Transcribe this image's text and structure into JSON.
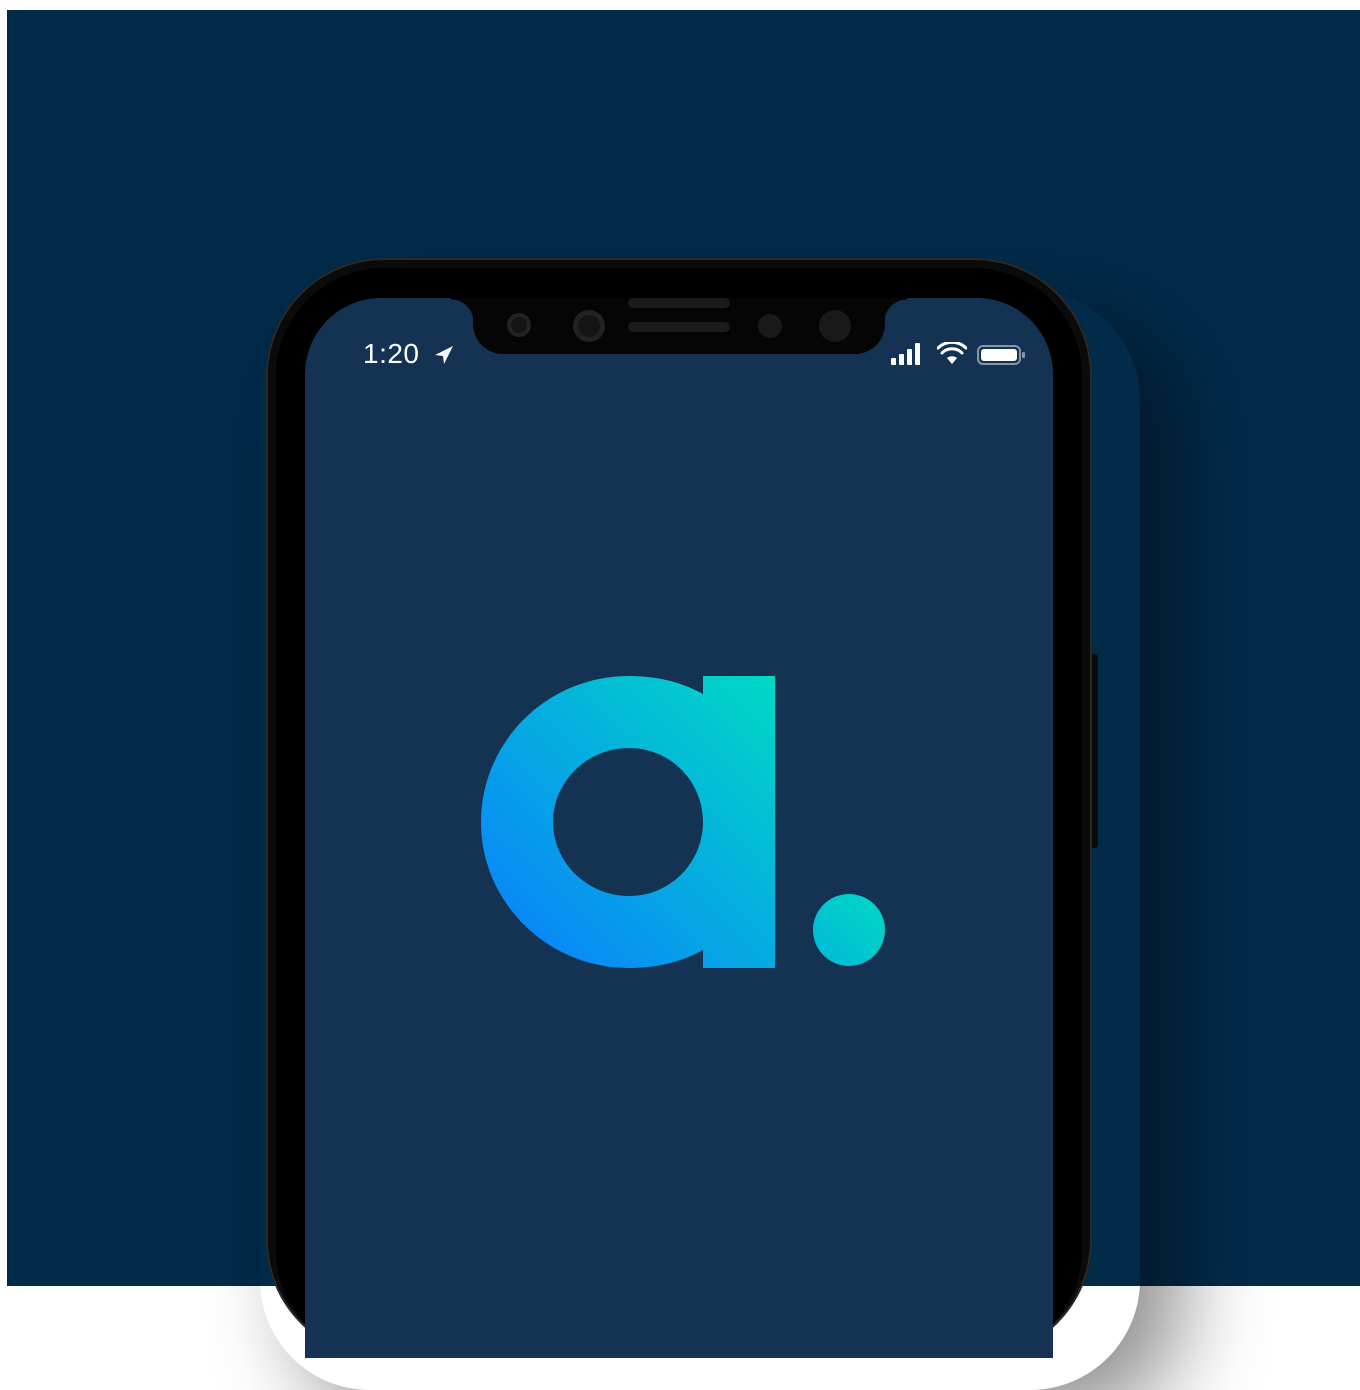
{
  "status_bar": {
    "time": "1:20",
    "location_icon": "location-arrow-icon",
    "signal_icon": "cellular-signal-icon",
    "wifi_icon": "wifi-icon",
    "battery_icon": "battery-icon"
  },
  "app": {
    "logo_text": "a.",
    "logo_gradient": [
      "#0a7cff",
      "#00d4c4"
    ],
    "background": "#143252"
  },
  "page": {
    "background": "#022b4a"
  }
}
